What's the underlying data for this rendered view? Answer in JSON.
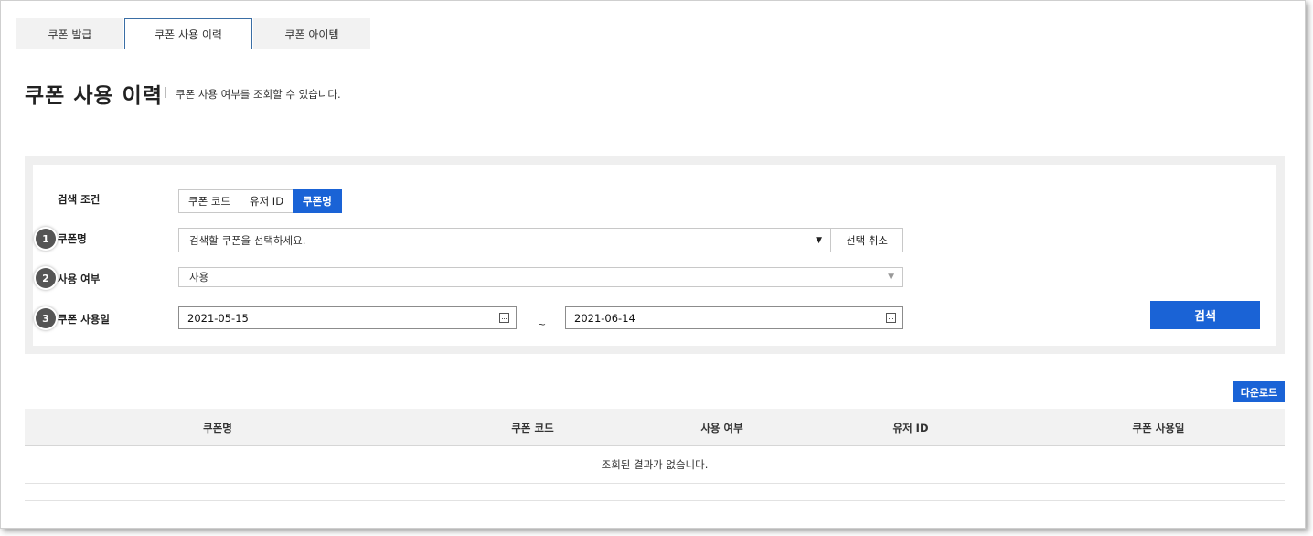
{
  "tabs": [
    {
      "label": "쿠폰 발급",
      "active": false
    },
    {
      "label": "쿠폰 사용 이력",
      "active": true
    },
    {
      "label": "쿠폰 아이템",
      "active": false
    }
  ],
  "header": {
    "title": "쿠폰 사용 이력",
    "description": "쿠폰 사용 여부를 조회할 수 있습니다."
  },
  "search": {
    "condition_label": "검색 조건",
    "condition_options": [
      "쿠폰 코드",
      "유저 ID",
      "쿠폰명"
    ],
    "condition_selected": "쿠폰명",
    "coupon_name": {
      "badge": "1",
      "label": "쿠폰명",
      "placeholder": "검색할 쿠폰을 선택하세요.",
      "cancel_label": "선택 취소"
    },
    "usage": {
      "badge": "2",
      "label": "사용 여부",
      "selected": "사용"
    },
    "use_date": {
      "badge": "3",
      "label": "쿠폰 사용일",
      "start": "2021-05-15",
      "separator": "~",
      "end": "2021-06-14"
    },
    "search_label": "검색"
  },
  "results": {
    "download_label": "다운로드",
    "columns": [
      "쿠폰명",
      "쿠폰 코드",
      "사용 여부",
      "유저 ID",
      "쿠폰 사용일"
    ],
    "empty_message": "조회된 결과가 없습니다."
  },
  "colors": {
    "primary": "#1a63d6",
    "badge": "#555555",
    "header_bg": "#f2f2f2"
  },
  "icons": {
    "dropdown": "caret-down-icon",
    "calendar": "calendar-icon"
  }
}
